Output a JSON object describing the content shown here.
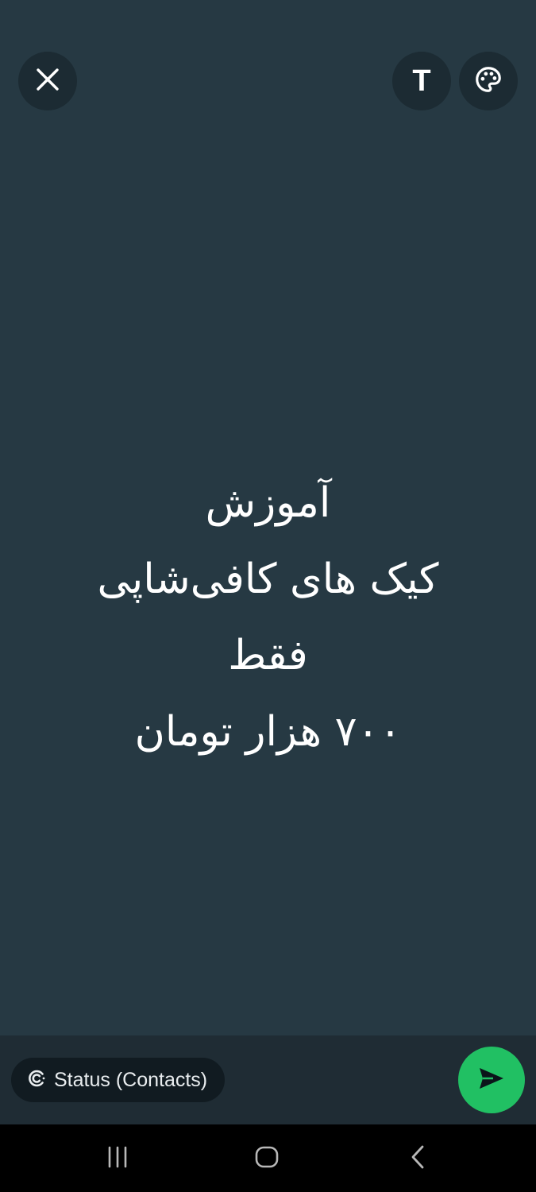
{
  "toolbar": {
    "close_icon": "close-icon",
    "text_tool_label": "T",
    "palette_icon": "palette-icon"
  },
  "status": {
    "lines": [
      "آموزش",
      "کیک های کافی‌شاپی",
      "فقط",
      "۷۰۰ هزار تومان"
    ],
    "background_color": "#263943",
    "text_color": "#ffffff"
  },
  "footer": {
    "audience_icon": "status-privacy-icon",
    "audience_label": "Status (Contacts)",
    "send_icon": "send-icon",
    "send_color": "#21c063"
  },
  "system_nav": {
    "recents_icon": "recents-icon",
    "home_icon": "home-icon",
    "back_icon": "back-icon"
  }
}
